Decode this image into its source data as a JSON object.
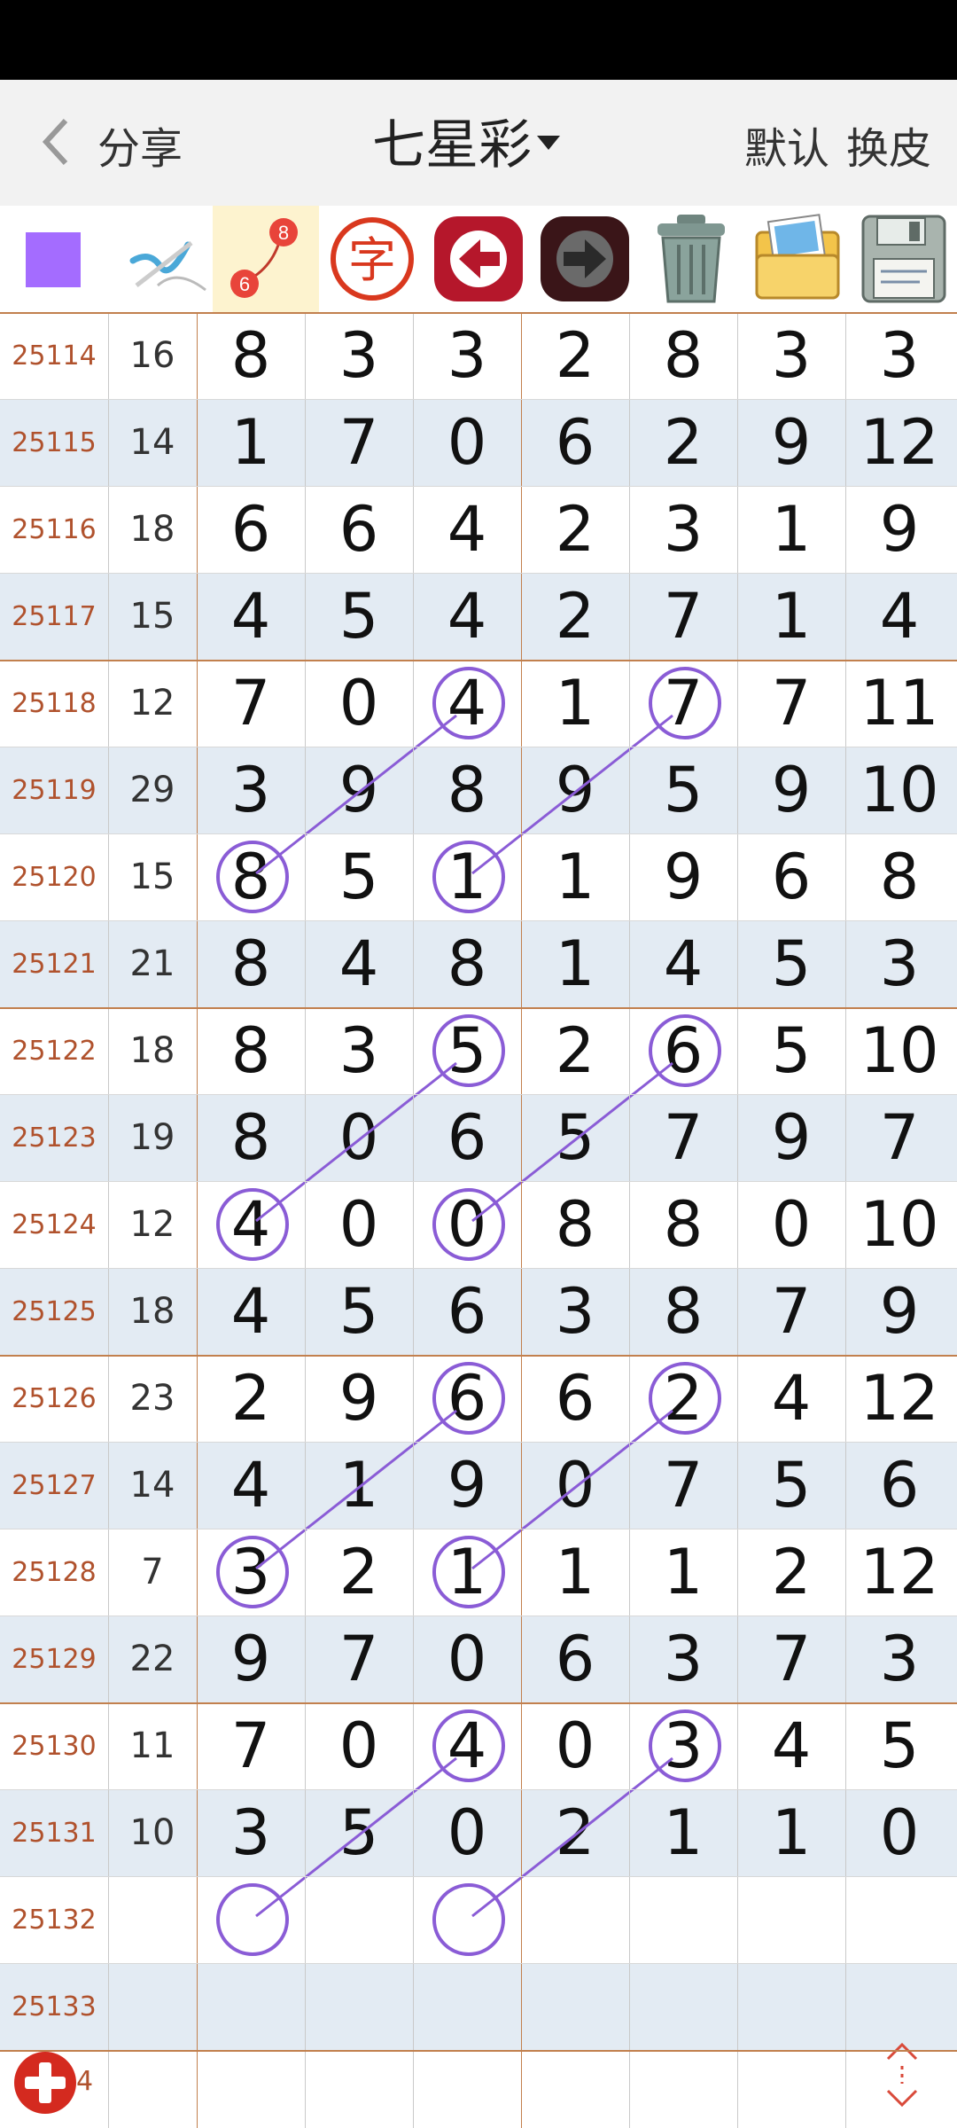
{
  "header": {
    "share_label": "分享",
    "title": "七星彩",
    "default_label": "默认",
    "skin_label": "换皮"
  },
  "toolbar": {
    "items": [
      {
        "name": "color-swatch",
        "color": "#a46cff"
      },
      {
        "name": "pen-tool-icon"
      },
      {
        "name": "connect-line-icon",
        "glyph_top": "8",
        "glyph_bottom": "6"
      },
      {
        "name": "text-tool-icon",
        "glyph": "字"
      },
      {
        "name": "undo-arrow-icon"
      },
      {
        "name": "redo-arrow-icon"
      },
      {
        "name": "trash-icon"
      },
      {
        "name": "image-folder-icon"
      },
      {
        "name": "save-disk-icon"
      }
    ]
  },
  "table": {
    "rows": [
      {
        "issue": "25114",
        "sum": "16",
        "d": [
          "8",
          "3",
          "3",
          "2",
          "8",
          "3",
          "3"
        ]
      },
      {
        "issue": "25115",
        "sum": "14",
        "d": [
          "1",
          "7",
          "0",
          "6",
          "2",
          "9",
          "12"
        ]
      },
      {
        "issue": "25116",
        "sum": "18",
        "d": [
          "6",
          "6",
          "4",
          "2",
          "3",
          "1",
          "9"
        ]
      },
      {
        "issue": "25117",
        "sum": "15",
        "d": [
          "4",
          "5",
          "4",
          "2",
          "7",
          "1",
          "4"
        ]
      },
      {
        "issue": "25118",
        "sum": "12",
        "d": [
          "7",
          "0",
          "4",
          "1",
          "7",
          "7",
          "11"
        ]
      },
      {
        "issue": "25119",
        "sum": "29",
        "d": [
          "3",
          "9",
          "8",
          "9",
          "5",
          "9",
          "10"
        ]
      },
      {
        "issue": "25120",
        "sum": "15",
        "d": [
          "8",
          "5",
          "1",
          "1",
          "9",
          "6",
          "8"
        ]
      },
      {
        "issue": "25121",
        "sum": "21",
        "d": [
          "8",
          "4",
          "8",
          "1",
          "4",
          "5",
          "3"
        ]
      },
      {
        "issue": "25122",
        "sum": "18",
        "d": [
          "8",
          "3",
          "5",
          "2",
          "6",
          "5",
          "10"
        ]
      },
      {
        "issue": "25123",
        "sum": "19",
        "d": [
          "8",
          "0",
          "6",
          "5",
          "7",
          "9",
          "7"
        ]
      },
      {
        "issue": "25124",
        "sum": "12",
        "d": [
          "4",
          "0",
          "0",
          "8",
          "8",
          "0",
          "10"
        ]
      },
      {
        "issue": "25125",
        "sum": "18",
        "d": [
          "4",
          "5",
          "6",
          "3",
          "8",
          "7",
          "9"
        ]
      },
      {
        "issue": "25126",
        "sum": "23",
        "d": [
          "2",
          "9",
          "6",
          "6",
          "2",
          "4",
          "12"
        ]
      },
      {
        "issue": "25127",
        "sum": "14",
        "d": [
          "4",
          "1",
          "9",
          "0",
          "7",
          "5",
          "6"
        ]
      },
      {
        "issue": "25128",
        "sum": "7",
        "d": [
          "3",
          "2",
          "1",
          "1",
          "1",
          "2",
          "12"
        ]
      },
      {
        "issue": "25129",
        "sum": "22",
        "d": [
          "9",
          "7",
          "0",
          "6",
          "3",
          "7",
          "3"
        ]
      },
      {
        "issue": "25130",
        "sum": "11",
        "d": [
          "7",
          "0",
          "4",
          "0",
          "3",
          "4",
          "5"
        ]
      },
      {
        "issue": "25131",
        "sum": "10",
        "d": [
          "3",
          "5",
          "0",
          "2",
          "1",
          "1",
          "0"
        ]
      },
      {
        "issue": "25132",
        "sum": "",
        "d": [
          "",
          "",
          "",
          "",
          "",
          "",
          ""
        ]
      },
      {
        "issue": "25133",
        "sum": "",
        "d": [
          "",
          "",
          "",
          "",
          "",
          "",
          ""
        ]
      }
    ],
    "last_issue_partial": "4"
  },
  "annotations": {
    "color": "#8a5cd6",
    "circles": [
      {
        "row": 4,
        "col": 2
      },
      {
        "row": 4,
        "col": 4
      },
      {
        "row": 6,
        "col": 0
      },
      {
        "row": 6,
        "col": 2
      },
      {
        "row": 8,
        "col": 2
      },
      {
        "row": 8,
        "col": 4
      },
      {
        "row": 10,
        "col": 0
      },
      {
        "row": 10,
        "col": 2
      },
      {
        "row": 12,
        "col": 2
      },
      {
        "row": 12,
        "col": 4
      },
      {
        "row": 14,
        "col": 0
      },
      {
        "row": 14,
        "col": 2
      },
      {
        "row": 16,
        "col": 2
      },
      {
        "row": 16,
        "col": 4
      },
      {
        "row": 18,
        "col": 0
      },
      {
        "row": 18,
        "col": 2
      }
    ],
    "lines": [
      {
        "from": {
          "row": 4,
          "col": 2
        },
        "to": {
          "row": 6,
          "col": 0
        }
      },
      {
        "from": {
          "row": 4,
          "col": 4
        },
        "to": {
          "row": 6,
          "col": 2
        }
      },
      {
        "from": {
          "row": 8,
          "col": 2
        },
        "to": {
          "row": 10,
          "col": 0
        }
      },
      {
        "from": {
          "row": 8,
          "col": 4
        },
        "to": {
          "row": 10,
          "col": 2
        }
      },
      {
        "from": {
          "row": 12,
          "col": 2
        },
        "to": {
          "row": 14,
          "col": 0
        }
      },
      {
        "from": {
          "row": 12,
          "col": 4
        },
        "to": {
          "row": 14,
          "col": 2
        }
      },
      {
        "from": {
          "row": 16,
          "col": 2
        },
        "to": {
          "row": 18,
          "col": 0
        }
      },
      {
        "from": {
          "row": 16,
          "col": 4
        },
        "to": {
          "row": 18,
          "col": 2
        }
      }
    ]
  }
}
